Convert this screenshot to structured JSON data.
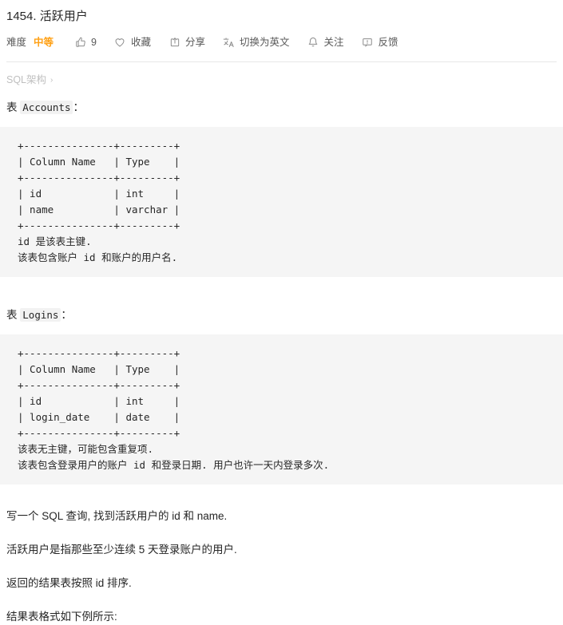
{
  "problem": {
    "title": "1454. 活跃用户"
  },
  "toolbar": {
    "difficulty_label": "难度",
    "difficulty_value": "中等",
    "difficulty_color": "#ffa116",
    "items": [
      {
        "icon": "thumbs-up-icon",
        "label": "9",
        "name": "like-button"
      },
      {
        "icon": "heart-icon",
        "label": "收藏",
        "name": "favorite-button"
      },
      {
        "icon": "share-icon",
        "label": "分享",
        "name": "share-button"
      },
      {
        "icon": "translate-icon",
        "label": "切换为英文",
        "name": "translate-button"
      },
      {
        "icon": "bell-icon",
        "label": "关注",
        "name": "subscribe-button"
      },
      {
        "icon": "comment-icon",
        "label": "反馈",
        "name": "feedback-button"
      }
    ]
  },
  "schema_section": {
    "label": "SQL架构",
    "caret": "›"
  },
  "tables": [
    {
      "caption_prefix": "表",
      "caption_name": "Accounts",
      "caption_suffix": "：",
      "code": "+---------------+---------+\n| Column Name   | Type    |\n+---------------+---------+\n| id            | int     |\n| name          | varchar |\n+---------------+---------+\nid 是该表主键.\n该表包含账户 id 和账户的用户名."
    },
    {
      "caption_prefix": "表",
      "caption_name": "Logins",
      "caption_suffix": "：",
      "code": "+---------------+---------+\n| Column Name   | Type    |\n+---------------+---------+\n| id            | int     |\n| login_date    | date    |\n+---------------+---------+\n该表无主键，可能包含重复项.\n该表包含登录用户的账户 id 和登录日期. 用户也许一天内登录多次."
    }
  ],
  "description": {
    "paragraphs": [
      "写一个 SQL 查询, 找到活跃用户的 id 和 name.",
      "活跃用户是指那些至少连续 5 天登录账户的用户.",
      "返回的结果表按照 id 排序.",
      "结果表格式如下例所示:"
    ]
  }
}
